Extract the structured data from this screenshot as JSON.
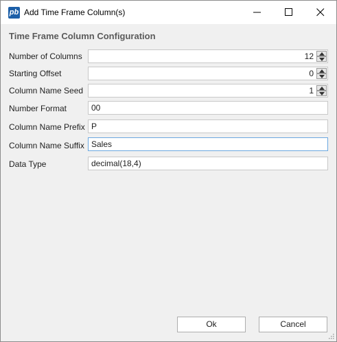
{
  "window": {
    "title": "Add Time Frame Column(s)",
    "icon_text": "pb",
    "controls": [
      "minimize-icon",
      "maximize-icon",
      "close-icon"
    ]
  },
  "form": {
    "section_title": "Time Frame Column Configuration",
    "fields": {
      "number_of_columns": {
        "label": "Number of Columns",
        "value": "12"
      },
      "starting_offset": {
        "label": "Starting Offset",
        "value": "0"
      },
      "column_name_seed": {
        "label": "Column Name Seed",
        "value": "1"
      },
      "number_format": {
        "label": "Number Format",
        "value": "00"
      },
      "column_name_prefix": {
        "label": "Column Name Prefix",
        "value": "P"
      },
      "column_name_suffix": {
        "label": "Column Name Suffix",
        "value": "Sales"
      },
      "data_type": {
        "label": "Data Type",
        "value": "decimal(18,4)"
      }
    }
  },
  "buttons": {
    "ok": "Ok",
    "cancel": "Cancel"
  },
  "colors": {
    "accent_focus": "#6aa7e0",
    "dialog_bg": "#f0f0f0",
    "titlebar_bg": "#ffffff",
    "icon_bg": "#1c5fa8"
  }
}
